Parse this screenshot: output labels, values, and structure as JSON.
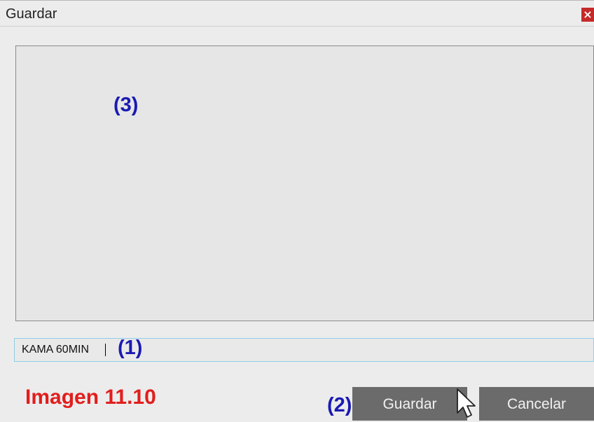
{
  "window": {
    "title": "Guardar",
    "close_glyph": "×"
  },
  "annotations": {
    "content_marker": "(3)",
    "input_marker": "(1)",
    "buttons_marker": "(2)"
  },
  "name_input": {
    "value": "KAMA 60MIN"
  },
  "buttons": {
    "save_label": "Guardar",
    "cancel_label": "Cancelar"
  },
  "caption": "Imagen 11.10",
  "colors": {
    "background": "#ececec",
    "button_bg": "#6b6b6b",
    "annotation_blue": "#1a1ab3",
    "caption_red": "#e21d1d",
    "close_red": "#c52a2a",
    "input_border": "#8fd0e6"
  },
  "icons": {
    "close": "close-icon",
    "cursor": "mouse-pointer-icon"
  }
}
